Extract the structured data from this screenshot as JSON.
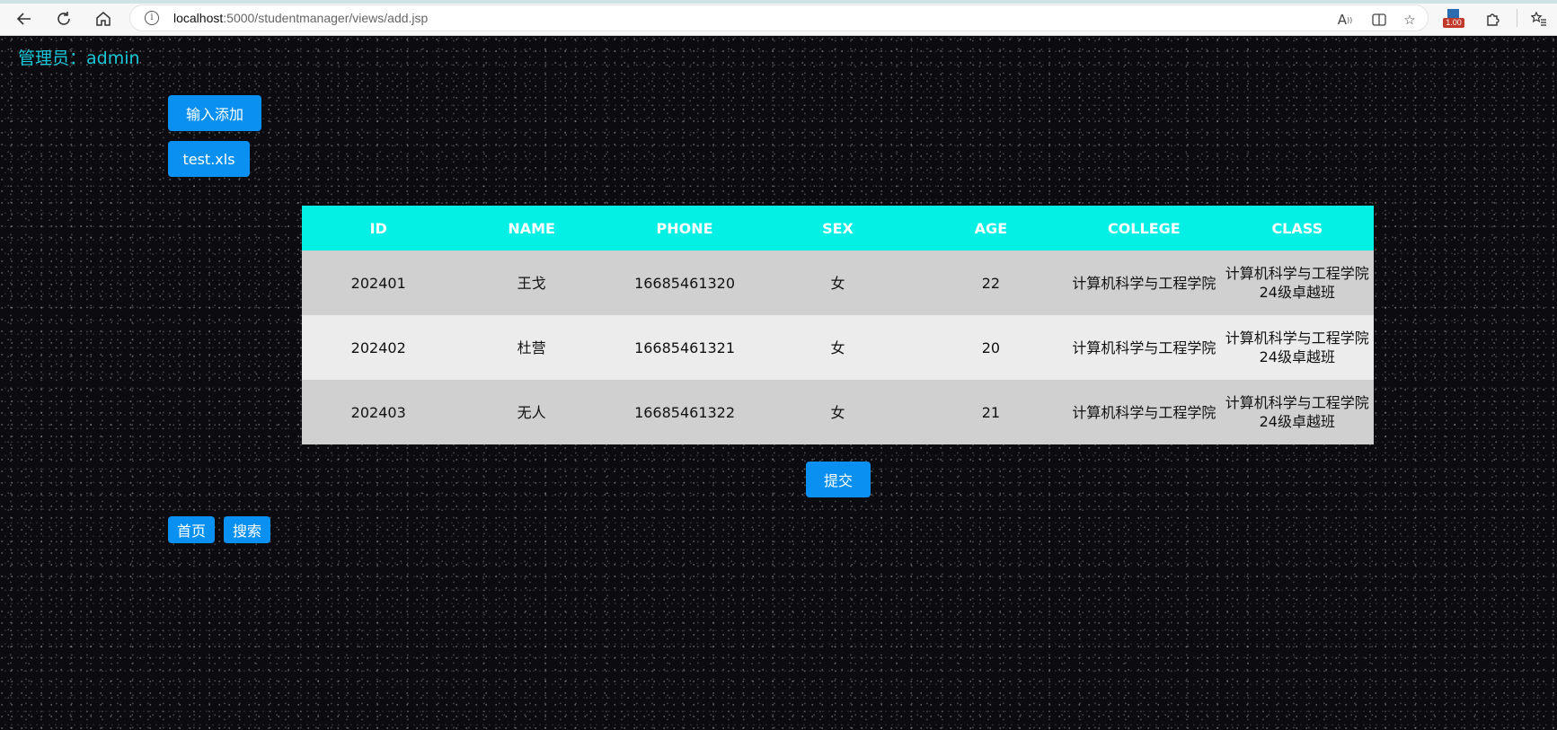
{
  "browser": {
    "url_host": "localhost",
    "url_rest": ":5000/studentmanager/views/add.jsp",
    "extension_badge": "1.00"
  },
  "header": {
    "admin_label": "管理员：admin"
  },
  "actions": {
    "input_add_label": "输入添加",
    "file_label": "test.xls",
    "submit_label": "提交",
    "home_label": "首页",
    "search_label": "搜索"
  },
  "table": {
    "columns": [
      "ID",
      "NAME",
      "PHONE",
      "SEX",
      "AGE",
      "COLLEGE",
      "CLASS"
    ],
    "rows": [
      {
        "id": "202401",
        "name": "王戈",
        "phone": "16685461320",
        "sex": "女",
        "age": "22",
        "college": "计算机科学与工程学院",
        "class": "计算机科学与工程学院24级卓越班"
      },
      {
        "id": "202402",
        "name": "杜营",
        "phone": "16685461321",
        "sex": "女",
        "age": "20",
        "college": "计算机科学与工程学院",
        "class": "计算机科学与工程学院24级卓越班"
      },
      {
        "id": "202403",
        "name": "无人",
        "phone": "16685461322",
        "sex": "女",
        "age": "21",
        "college": "计算机科学与工程学院",
        "class": "计算机科学与工程学院24级卓越班"
      }
    ]
  },
  "colors": {
    "header_bg": "#04f0e4",
    "button_bg": "#0a90f0",
    "admin_text": "#19c8d8",
    "row_odd": "#d0d0d0",
    "row_even": "#ececec"
  }
}
